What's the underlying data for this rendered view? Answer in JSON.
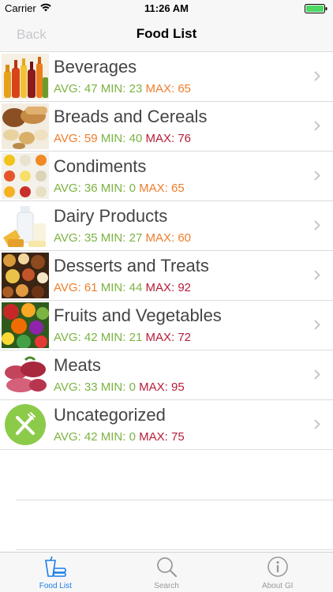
{
  "status_bar": {
    "carrier": "Carrier",
    "time": "11:26 AM"
  },
  "nav": {
    "back_label": "Back",
    "title": "Food List"
  },
  "colors": {
    "low": "#7cb342",
    "mid": "#ef7d2c",
    "high": "#b71c36",
    "accent": "#1a7ee8"
  },
  "rows": [
    {
      "title": "Beverages",
      "avg_label": "AVG:",
      "avg": "47",
      "min_label": "MIN:",
      "min": "23",
      "max_label": "MAX:",
      "max": "65",
      "avg_level": "low",
      "min_level": "low",
      "max_level": "mid",
      "thumb": "beverages"
    },
    {
      "title": "Breads and Cereals",
      "avg_label": "AVG:",
      "avg": "59",
      "min_label": "MIN:",
      "min": "40",
      "max_label": "MAX:",
      "max": "76",
      "avg_level": "mid",
      "min_level": "low",
      "max_level": "high",
      "thumb": "breads"
    },
    {
      "title": "Condiments",
      "avg_label": "AVG:",
      "avg": "36",
      "min_label": "MIN:",
      "min": "0",
      "max_label": "MAX:",
      "max": "65",
      "avg_level": "low",
      "min_level": "low",
      "max_level": "mid",
      "thumb": "condiments"
    },
    {
      "title": "Dairy Products",
      "avg_label": "AVG:",
      "avg": "35",
      "min_label": "MIN:",
      "min": "27",
      "max_label": "MAX:",
      "max": "60",
      "avg_level": "low",
      "min_level": "low",
      "max_level": "mid",
      "thumb": "dairy"
    },
    {
      "title": "Desserts and Treats",
      "avg_label": "AVG:",
      "avg": "61",
      "min_label": "MIN:",
      "min": "44",
      "max_label": "MAX:",
      "max": "92",
      "avg_level": "mid",
      "min_level": "low",
      "max_level": "high",
      "thumb": "desserts"
    },
    {
      "title": "Fruits and Vegetables",
      "avg_label": "AVG:",
      "avg": "42",
      "min_label": "MIN:",
      "min": "21",
      "max_label": "MAX:",
      "max": "72",
      "avg_level": "low",
      "min_level": "low",
      "max_level": "high",
      "thumb": "fruits"
    },
    {
      "title": "Meats",
      "avg_label": "AVG:",
      "avg": "33",
      "min_label": "MIN:",
      "min": "0",
      "max_label": "MAX:",
      "max": "95",
      "avg_level": "low",
      "min_level": "low",
      "max_level": "high",
      "thumb": "meats"
    },
    {
      "title": "Uncategorized",
      "avg_label": "AVG:",
      "avg": "42",
      "min_label": "MIN:",
      "min": "0",
      "max_label": "MAX:",
      "max": "75",
      "avg_level": "low",
      "min_level": "low",
      "max_level": "high",
      "thumb": "uncategorized"
    }
  ],
  "tabs": [
    {
      "label": "Food List",
      "icon": "food-list-icon",
      "active": true
    },
    {
      "label": "Search",
      "icon": "magnifier-icon",
      "active": false
    },
    {
      "label": "About GI",
      "icon": "info-icon",
      "active": false
    }
  ]
}
